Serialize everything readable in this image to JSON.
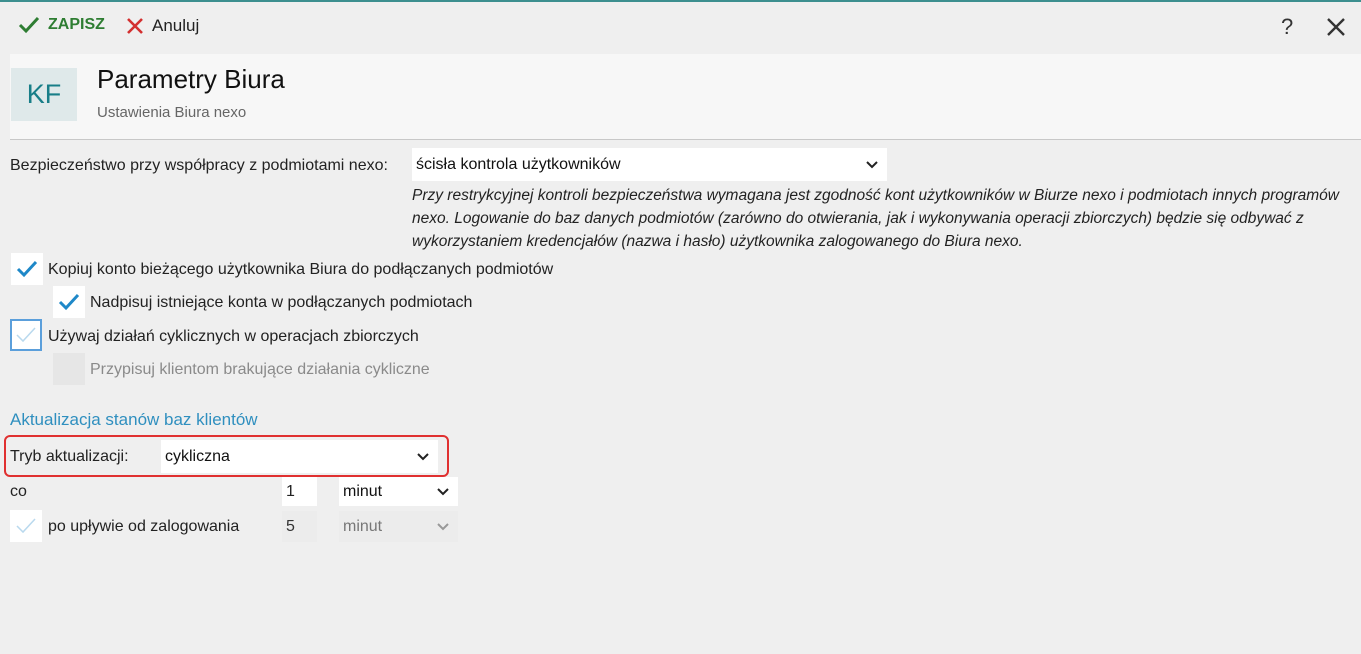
{
  "toolbar": {
    "save_label": "ZAPISZ",
    "cancel_label": "Anuluj",
    "help_label": "?"
  },
  "header": {
    "logo_text": "KF",
    "title": "Parametry Biura",
    "subtitle": "Ustawienia Biura nexo"
  },
  "security": {
    "label": "Bezpieczeństwo przy współpracy z podmiotami nexo:",
    "value": "ścisła kontrola użytkowników",
    "note": "Przy restrykcyjnej kontroli bezpieczeństwa wymagana jest zgodność kont użytkowników w Biurze nexo i podmiotach innych programów nexo. Logowanie do baz danych podmiotów (zarówno do otwierania, jak i wykonywania operacji zbiorczych) będzie się odbywać z wykorzystaniem kredencjałów (nazwa i hasło) użytkownika zalogowanego do Biura nexo."
  },
  "checkboxes": [
    {
      "label": "Kopiuj konto bieżącego użytkownika Biura do podłączanych podmiotów",
      "checked": true
    },
    {
      "label": "Nadpisuj istniejące konta w podłączanych podmiotach",
      "checked": true
    },
    {
      "label": "Używaj działań cyklicznych w operacjach zbiorczych",
      "checked": false
    },
    {
      "label": "Przypisuj klientom brakujące działania cykliczne",
      "checked": false
    }
  ],
  "update": {
    "section_title": "Aktualizacja stanów baz klientów",
    "mode_label": "Tryb aktualizacji:",
    "mode_value": "cykliczna",
    "every_label": "co",
    "every_value": "1",
    "every_unit": "minut",
    "after_login_label": "po upływie od zalogowania",
    "after_login_value": "5",
    "after_login_unit": "minut"
  },
  "colors": {
    "accent": "#187e88",
    "save_green": "#2e7d32",
    "cancel_red": "#d32f2f",
    "check_blue": "#1e88c8",
    "section_blue": "#2f8fbf",
    "highlight_red": "#e03030"
  },
  "icons": [
    "check-icon",
    "x-icon",
    "help-icon",
    "close-icon",
    "chevron-down-icon"
  ]
}
